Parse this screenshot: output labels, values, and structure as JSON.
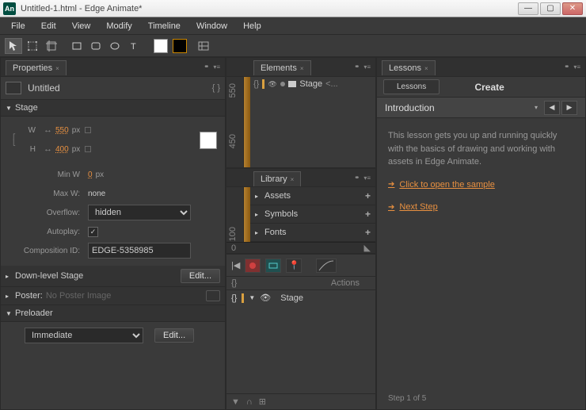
{
  "window": {
    "title": "Untitled-1.html - Edge Animate*",
    "app_icon": "An"
  },
  "menu": [
    "File",
    "Edit",
    "View",
    "Modify",
    "Timeline",
    "Window",
    "Help"
  ],
  "panels": {
    "properties": {
      "title": "Properties",
      "comp_name": "Untitled",
      "stage": {
        "title": "Stage",
        "w_label": "W",
        "w": "550",
        "w_unit": "px",
        "h_label": "H",
        "h": "400",
        "h_unit": "px",
        "minw_label": "Min W",
        "minw": "0",
        "minw_unit": "px",
        "maxw_label": "Max W:",
        "maxw": "none",
        "overflow_label": "Overflow:",
        "overflow": "hidden",
        "autoplay_label": "Autoplay:",
        "compid_label": "Composition ID:",
        "compid": "EDGE-5358985"
      },
      "downlevel": {
        "title": "Down-level Stage",
        "btn": "Edit..."
      },
      "poster": {
        "title": "Poster:",
        "value": "No Poster Image"
      },
      "preloader": {
        "title": "Preloader",
        "mode": "Immediate",
        "btn": "Edit..."
      }
    },
    "elements": {
      "title": "Elements",
      "root": "Stage",
      "root_extra": "<..."
    },
    "library": {
      "title": "Library",
      "sections": [
        "Assets",
        "Symbols",
        "Fonts"
      ]
    },
    "timeline": {
      "actions_label": "Actions",
      "root": "Stage"
    },
    "lessons": {
      "title": "Lessons",
      "tab_lessons": "Lessons",
      "tab_create": "Create",
      "section": "Introduction",
      "body": "This lesson gets you up and running quickly with the basics of drawing and working with assets in Edge Animate.",
      "link1": "Click to open the sample",
      "link2": "Next Step",
      "step": "Step 1 of 5"
    }
  },
  "ruler": {
    "t1": "550",
    "t2": "450",
    "t3": "100"
  }
}
